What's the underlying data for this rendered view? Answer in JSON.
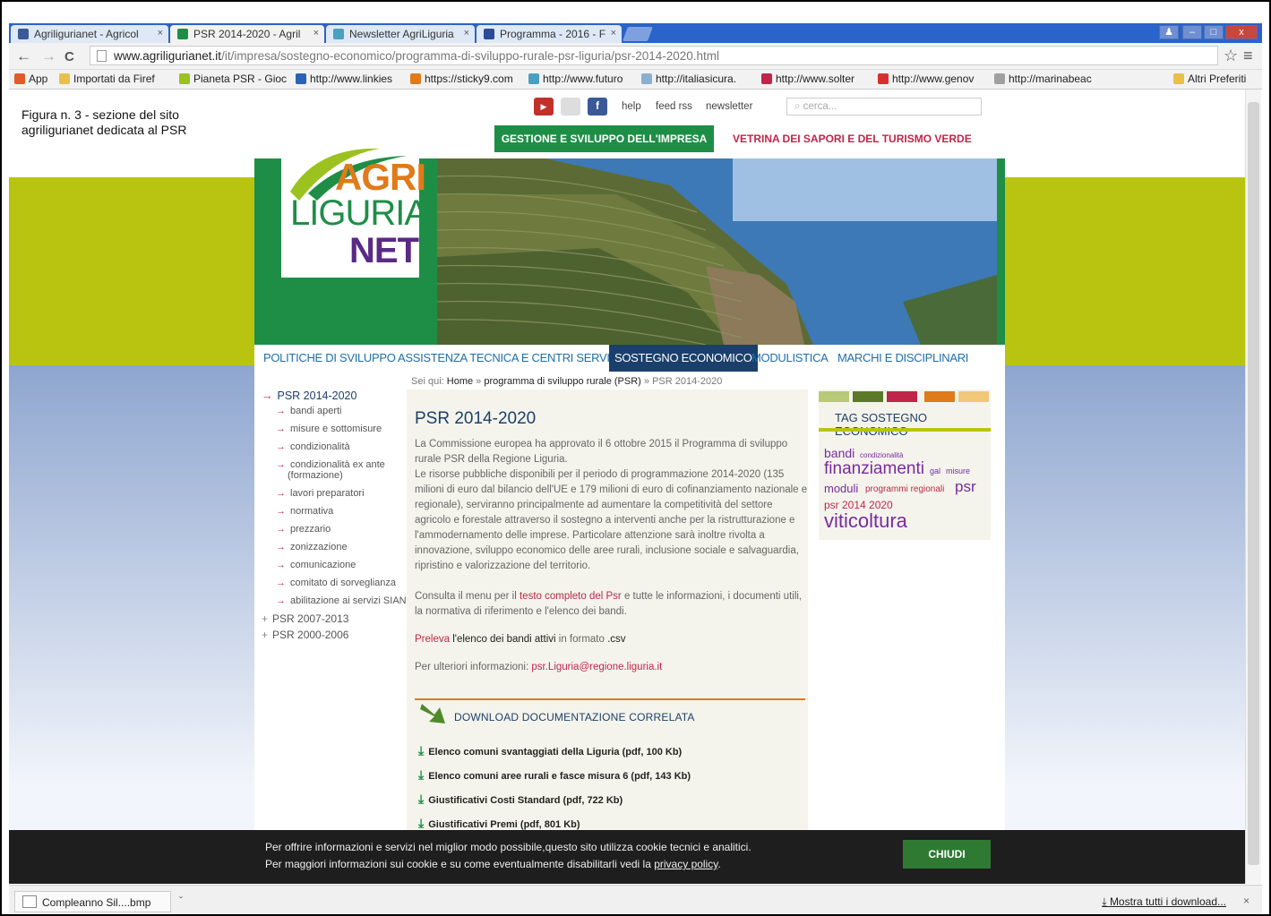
{
  "browser": {
    "tabs": [
      {
        "title": "Agriligurianet - Agricol",
        "icon_color": "#3b5998"
      },
      {
        "title": "PSR 2014-2020 - Agril",
        "icon_color": "#1e8e47"
      },
      {
        "title": "Newsletter AgriLiguria",
        "icon_color": "#4aa0c0"
      },
      {
        "title": "Programma - 2016 - F",
        "icon_color": "#2a4a9a"
      }
    ],
    "tab_close": "×",
    "window_controls": {
      "minimize": "–",
      "maximize": "□",
      "close": "x",
      "user": "♟"
    },
    "url_host": "www.agriligurianet.it",
    "url_path": "/it/impresa/sostegno-economico/programma-di-sviluppo-rurale-psr-liguria/psr-2014-2020.html",
    "nav": {
      "back": "←",
      "forward": "→",
      "reload": "C",
      "star": "☆",
      "menu": "≡"
    },
    "bookmarks": [
      {
        "label": "App",
        "color": "#e25b2a"
      },
      {
        "label": "Importati da Firef",
        "color": "#e8c04a"
      },
      {
        "label": "Pianeta PSR - Gioc",
        "color": "#9bc21f"
      },
      {
        "label": "http://www.linkies",
        "color": "#2a62b8"
      },
      {
        "label": "https://sticky9.com",
        "color": "#e07a1a"
      },
      {
        "label": "http://www.futuro",
        "color": "#4aa0c0"
      },
      {
        "label": "http://italiasicura.",
        "color": "#8ab0d0"
      },
      {
        "label": "http://www.solter",
        "color": "#c0264a"
      },
      {
        "label": "http://www.genov",
        "color": "#d83030"
      },
      {
        "label": "http://marinabeac",
        "color": "#a0a0a0"
      }
    ],
    "other_bookmarks": "Altri Preferiti"
  },
  "caption": "Figura n. 3 - sezione del sito agriligurianet dedicata al PSR",
  "site": {
    "top_links": {
      "help": "help",
      "feed": "feed rss",
      "newsletter": "newsletter"
    },
    "search_placeholder": "cerca...",
    "header_tabs": {
      "impresa": "GESTIONE E SVILUPPO DELL'IMPRESA",
      "vetrina": "VETRINA DEI SAPORI E DEL TURISMO VERDE"
    },
    "logo": {
      "line1": "AGRI",
      "line2": "LIGURIA",
      "line3": "NET"
    },
    "menu": [
      "POLITICHE DI SVILUPPO",
      "ASSISTENZA TECNICA E CENTRI SERVIZI",
      "SOSTEGNO ECONOMICO",
      "MODULISTICA",
      "MARCHI E DISCIPLINARI"
    ],
    "breadcrumb": {
      "prefix": "Sei qui:",
      "home": "Home",
      "sep1": "»",
      "section": "programma di sviluppo rurale (PSR)",
      "sep2": "»",
      "current": "PSR 2014-2020"
    },
    "sidenav": {
      "top": "PSR 2014-2020",
      "items": [
        "bandi aperti",
        "misure e sottomisure",
        "condizionalità",
        "condizionalità ex ante",
        "(formazione)",
        "lavori preparatori",
        "normativa",
        "prezzario",
        "zonizzazione",
        "comunicazione",
        "comitato di sorveglianza",
        "abilitazione ai servizi SIAN"
      ],
      "others": [
        "PSR 2007-2013",
        "PSR 2000-2006"
      ]
    },
    "main": {
      "title": "PSR 2014-2020",
      "p1": "La Commissione europea ha approvato il 6 ottobre 2015 il Programma di sviluppo rurale PSR della Regione Liguria.",
      "p2": "Le risorse pubbliche disponibili per il periodo di programmazione 2014-2020 (135 milioni di euro dal bilancio dell'UE e 179 milioni di euro di cofinanziamento nazionale e regionale), serviranno principalmente ad aumentare la competitività del settore agricolo e forestale attraverso il sostegno a interventi anche per la ristrutturazione e l'ammodernamento delle imprese. Particolare attenzione sarà inoltre rivolta a innovazione, sviluppo economico delle aree rurali, inclusione sociale e salvaguardia, ripristino e valorizzazione del territorio.",
      "p3_a": "Consulta il menu per il",
      "p3_link": "testo completo del Psr",
      "p3_b": "e tutte le informazioni, i documenti utili, la normativa di riferimento e l'elenco dei bandi.",
      "p4_link": "Preleva",
      "p4_bold": "l'elenco dei bandi attivi",
      "p4_rest": "in formato",
      "p4_fmt": ".csv",
      "p5": "Per ulteriori informazioni:",
      "p5_link": "psr.Liguria@regione.liguria.it",
      "download_title": "DOWNLOAD DOCUMENTAZIONE CORRELATA",
      "downloads": [
        "Elenco comuni svantaggiati della Liguria (pdf, 100 Kb)",
        "Elenco comuni aree rurali e fasce misura 6 (pdf, 143 Kb)",
        "Giustificativi Costi Standard (pdf, 722 Kb)",
        "Giustificativi Premi (pdf, 801 Kb)"
      ]
    },
    "tags": {
      "title": "TAG SOSTEGNO ECONOMICO",
      "items": [
        "bandi",
        "condizionalità",
        "finanziamenti",
        "gal",
        "misure",
        "moduli",
        "programmi regionali",
        "psr",
        "psr 2014 2020",
        "viticoltura"
      ],
      "bar_colors": [
        "#b9c977",
        "#5a7a2a",
        "#c0264a",
        "#e07a1a",
        "#f0c878"
      ]
    },
    "colors": {
      "green": "#1e8e47",
      "navy": "#1a3f6b",
      "magenta": "#c0264a",
      "olive": "#b9c411"
    }
  },
  "cookie": {
    "line1": "Per offrire informazioni e servizi nel miglior modo possibile,questo sito utilizza cookie tecnici e analitici.",
    "line2": "Per maggiori informazioni sui cookie e su come eventualmente disabilitarli vedi la",
    "link": "privacy policy",
    "end": ".",
    "button": "CHIUDI"
  },
  "download_bar": {
    "file": "Compleanno Sil....bmp",
    "show_all": "Mostra tutti i download...",
    "arrow": "ˇ",
    "close": "×"
  }
}
